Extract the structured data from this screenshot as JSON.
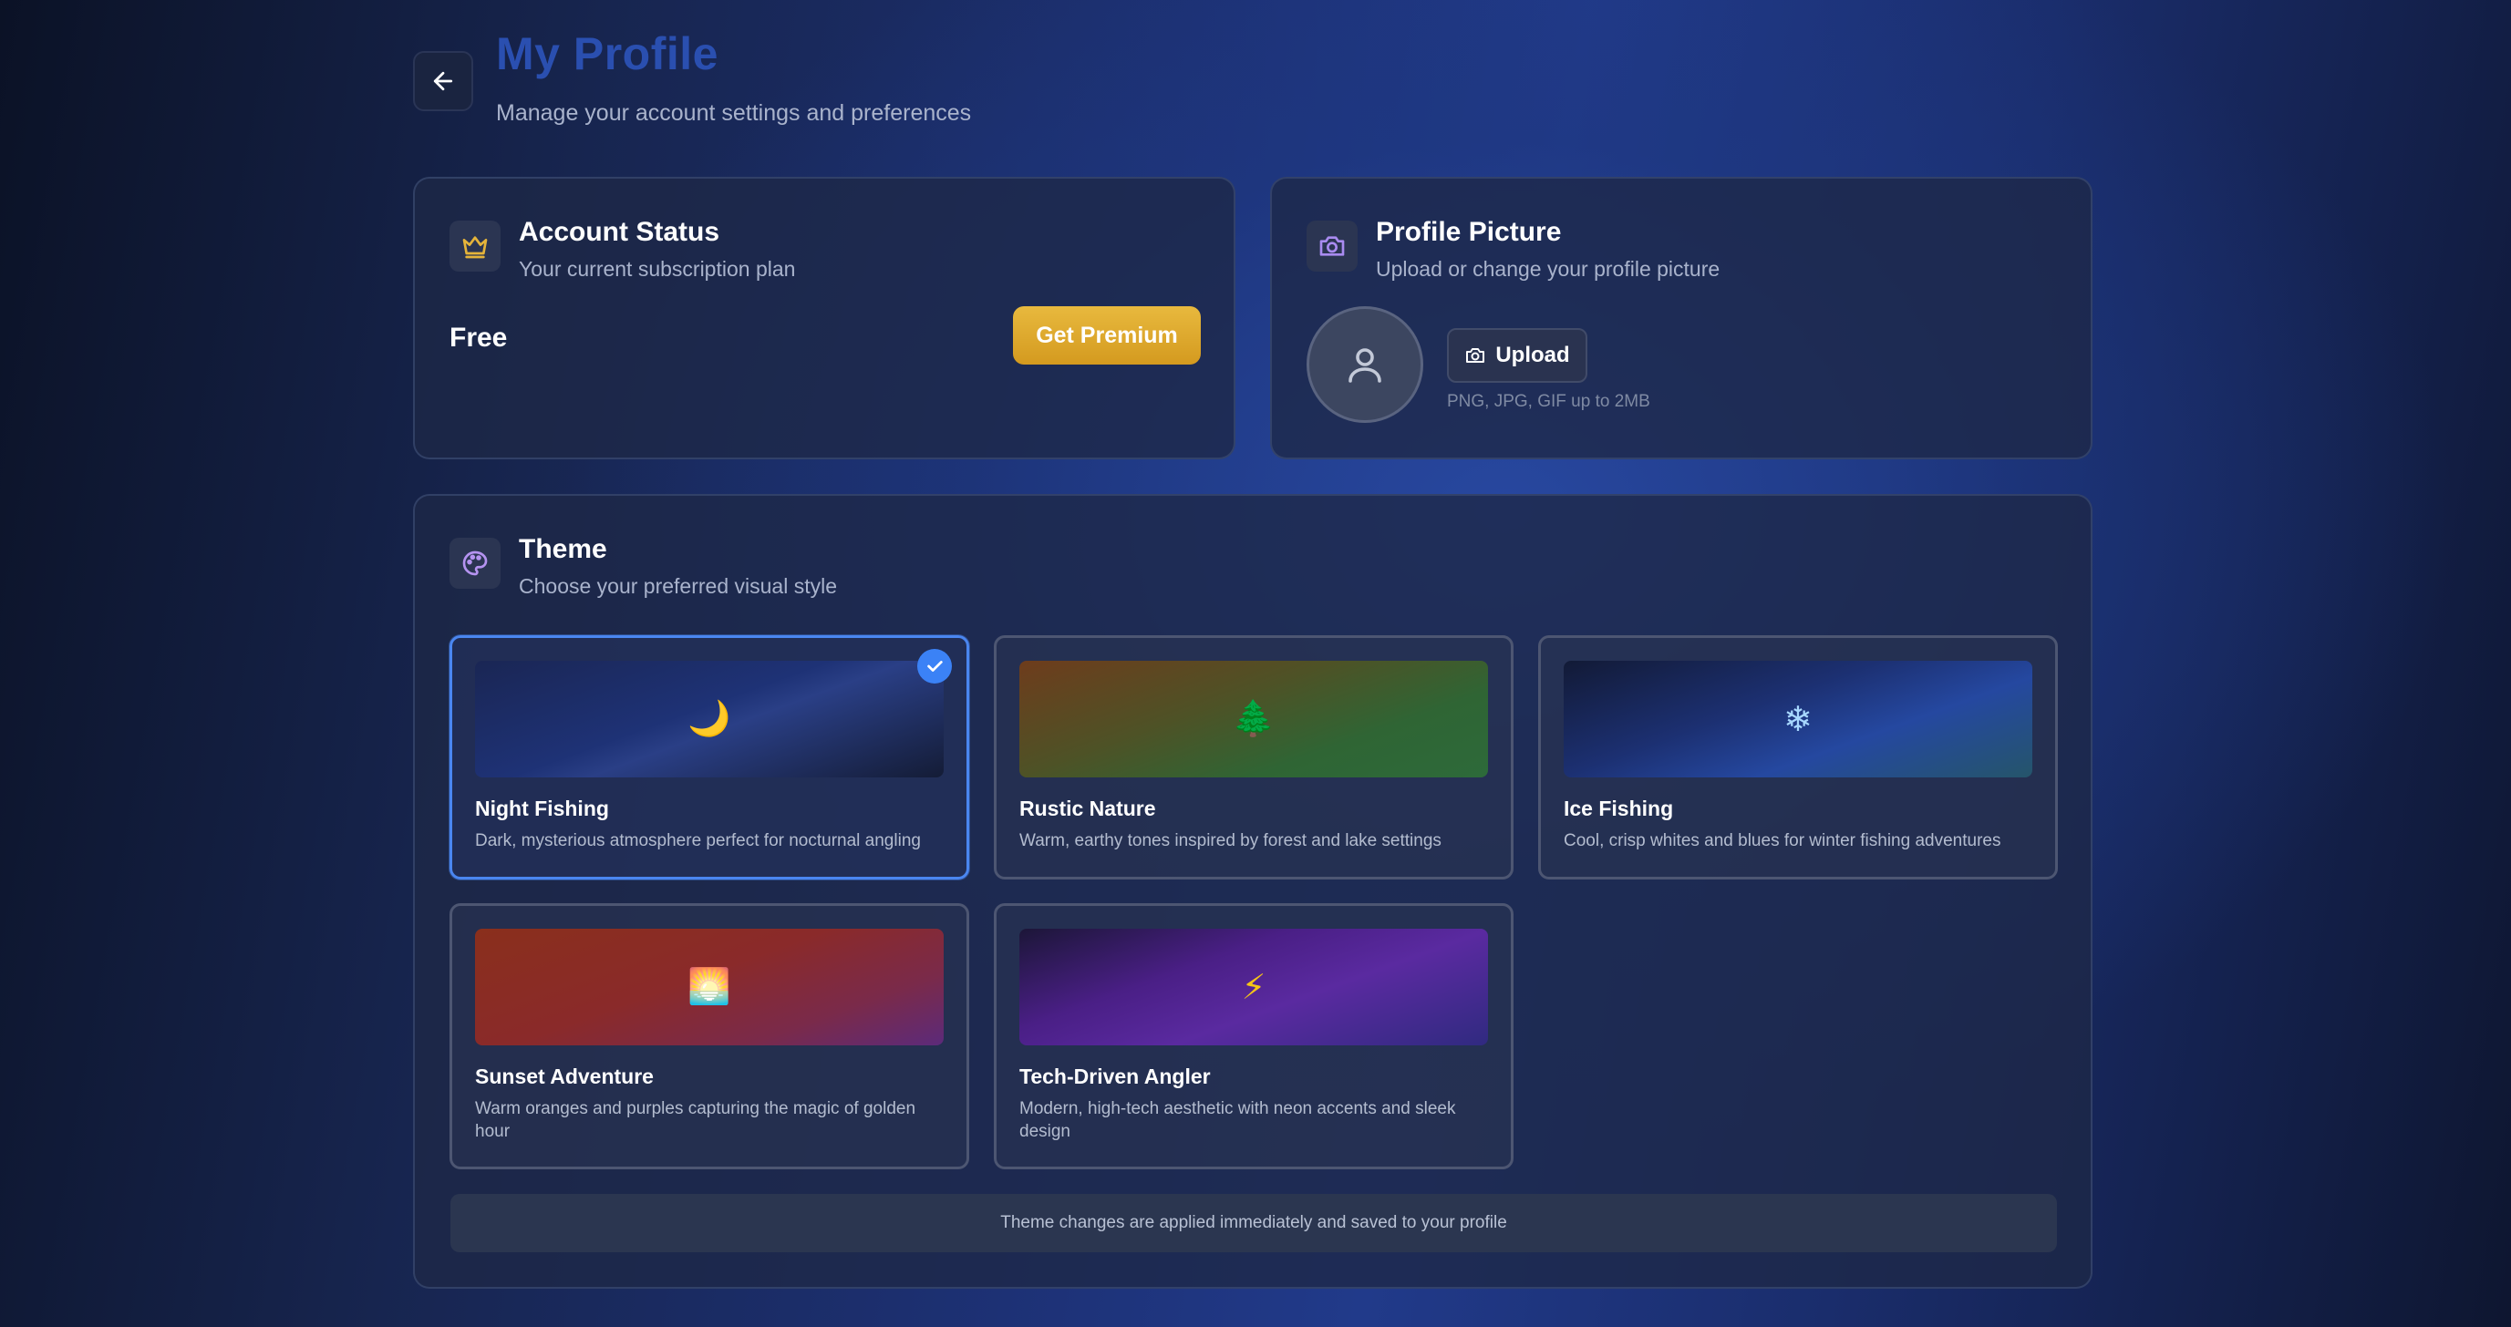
{
  "header": {
    "title": "My Profile",
    "subtitle": "Manage your account settings and preferences",
    "back_icon": "arrow-left-icon"
  },
  "account_status": {
    "title": "Account Status",
    "subtitle": "Your current subscription plan",
    "icon": "crown-icon",
    "plan": "Free",
    "premium_button": "Get Premium"
  },
  "profile_picture": {
    "title": "Profile Picture",
    "subtitle": "Upload or change your profile picture",
    "icon": "camera-icon",
    "upload_button": "Upload",
    "hint": "PNG, JPG, GIF up to 2MB"
  },
  "theme": {
    "title": "Theme",
    "subtitle": "Choose your preferred visual style",
    "icon": "palette-icon",
    "options": [
      {
        "name": "Night Fishing",
        "description": "Dark, mysterious atmosphere perfect for nocturnal angling",
        "emoji": "🌙",
        "selected": true
      },
      {
        "name": "Rustic Nature",
        "description": "Warm, earthy tones inspired by forest and lake settings",
        "emoji": "🌲",
        "selected": false
      },
      {
        "name": "Ice Fishing",
        "description": "Cool, crisp whites and blues for winter fishing adventures",
        "emoji": "❄",
        "selected": false
      },
      {
        "name": "Sunset Adventure",
        "description": "Warm oranges and purples capturing the magic of golden hour",
        "emoji": "🌅",
        "selected": false
      },
      {
        "name": "Tech-Driven Angler",
        "description": "Modern, high-tech aesthetic with neon accents and sleek design",
        "emoji": "⚡",
        "selected": false
      }
    ],
    "footer_note": "Theme changes are applied immediately and saved to your profile"
  },
  "colors": {
    "accent": "#3b82f6",
    "title_blue": "#2a4fb0",
    "premium_gold": "#e0aa2e"
  }
}
